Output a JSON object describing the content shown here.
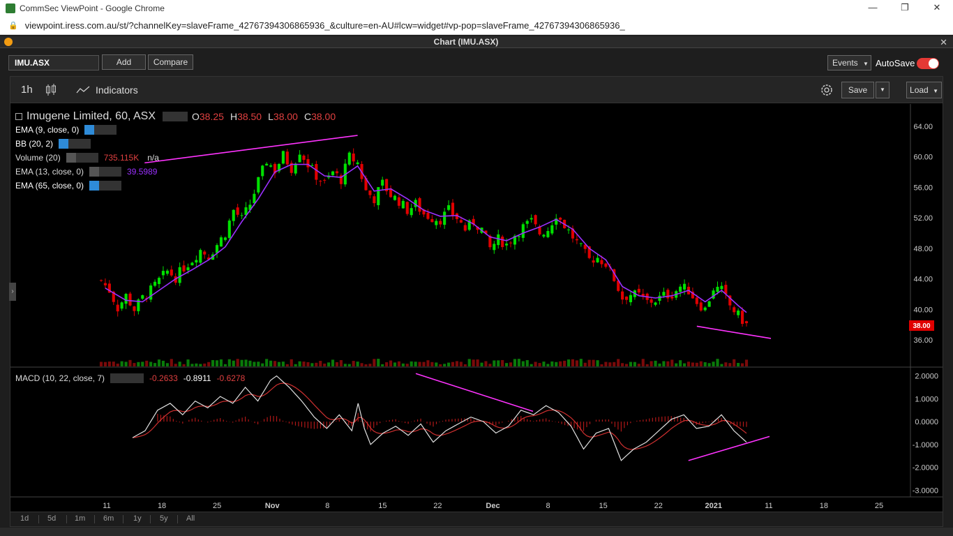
{
  "window": {
    "title": "CommSec ViewPoint - Google Chrome",
    "url": "viewpoint.iress.com.au/st/?channelKey=slaveFrame_42767394306865936_&culture=en-AU#lcw=widget#vp-pop=slaveFrame_42767394306865936_",
    "minimize": "—",
    "restore": "❐",
    "close": "✕"
  },
  "panel": {
    "title": "Chart (IMU.ASX)",
    "close": "✕"
  },
  "toolbar": {
    "symbol": "IMU.ASX",
    "add": "Add",
    "compare": "Compare",
    "events": "Events",
    "autosave": "AutoSave"
  },
  "chart_toolbar": {
    "interval": "1h",
    "indicators": "Indicators",
    "save": "Save",
    "load": "Load"
  },
  "legend": {
    "name": "Imugene Limited, 60, ASX",
    "o_label": "O",
    "o": "38.25",
    "h_label": "H",
    "h": "38.50",
    "l_label": "L",
    "l": "38.00",
    "c_label": "C",
    "c": "38.00",
    "studies": [
      {
        "label": "EMA (9, close, 0)",
        "value": ""
      },
      {
        "label": "BB (20, 2)",
        "value": ""
      },
      {
        "label": "Volume (20)",
        "value": "735.115K",
        "value2": "n/a"
      },
      {
        "label": "EMA (13, close, 0)",
        "value": "39.5989"
      },
      {
        "label": "EMA (65, close, 0)",
        "value": ""
      }
    ],
    "macd_label": "MACD (10, 22, close, 7)",
    "macd_values": [
      "-0.2633",
      "-0.8911",
      "-0.6278"
    ]
  },
  "colors": {
    "up": "#00e000",
    "down": "#e00000",
    "ema": "#9b30ff",
    "trendline": "#ff33ff",
    "price_tag": "#e00000",
    "macd_line": "#e0e0e0",
    "signal_line": "#d03030"
  },
  "last_price_tag": "38.00",
  "chart_data": [
    {
      "type": "candlestick",
      "ylim": [
        34,
        66
      ],
      "y_ticks": [
        "64.00",
        "60.00",
        "56.00",
        "52.00",
        "48.00",
        "44.00",
        "40.00",
        "36.00"
      ],
      "x_ticks": [
        "11",
        "18",
        "25",
        "Nov",
        "8",
        "15",
        "22",
        "Dec",
        "8",
        "15",
        "22",
        "2021",
        "11",
        "18",
        "25"
      ],
      "close_path": [
        [
          0,
          43.8
        ],
        [
          2,
          42.5
        ],
        [
          4,
          40.2
        ],
        [
          6,
          41.8
        ],
        [
          8,
          40.0
        ],
        [
          10,
          41.5
        ],
        [
          12,
          42.5
        ],
        [
          14,
          43.8
        ],
        [
          16,
          45.0
        ],
        [
          18,
          44.2
        ],
        [
          20,
          45.5
        ],
        [
          22,
          46.5
        ],
        [
          24,
          47.8
        ],
        [
          26,
          47.0
        ],
        [
          28,
          48.5
        ],
        [
          30,
          50.0
        ],
        [
          32,
          53.0
        ],
        [
          34,
          51.8
        ],
        [
          36,
          53.8
        ],
        [
          38,
          56.8
        ],
        [
          40,
          59.5
        ],
        [
          42,
          58.2
        ],
        [
          44,
          60.2
        ],
        [
          46,
          58.5
        ],
        [
          48,
          60.8
        ],
        [
          50,
          59.0
        ],
        [
          52,
          57.5
        ],
        [
          54,
          56.5
        ],
        [
          56,
          58.0
        ],
        [
          58,
          57.0
        ],
        [
          60,
          60.0
        ],
        [
          62,
          59.2
        ],
        [
          64,
          55.5
        ],
        [
          66,
          54.5
        ],
        [
          68,
          56.5
        ],
        [
          70,
          55.0
        ],
        [
          72,
          54.2
        ],
        [
          74,
          53.0
        ],
        [
          76,
          53.8
        ],
        [
          78,
          52.5
        ],
        [
          80,
          52.0
        ],
        [
          82,
          51.8
        ],
        [
          84,
          53.0
        ],
        [
          86,
          52.0
        ],
        [
          88,
          50.5
        ],
        [
          90,
          51.5
        ],
        [
          92,
          50.5
        ],
        [
          94,
          48.0
        ],
        [
          96,
          49.2
        ],
        [
          98,
          48.5
        ],
        [
          100,
          49.8
        ],
        [
          102,
          50.8
        ],
        [
          104,
          51.5
        ],
        [
          106,
          50.0
        ],
        [
          108,
          50.5
        ],
        [
          110,
          52.5
        ],
        [
          112,
          51.0
        ],
        [
          114,
          49.5
        ],
        [
          116,
          48.0
        ],
        [
          118,
          46.5
        ],
        [
          120,
          46.8
        ],
        [
          122,
          46.0
        ],
        [
          124,
          44.0
        ],
        [
          126,
          41.5
        ],
        [
          128,
          42.0
        ],
        [
          130,
          41.8
        ],
        [
          132,
          41.0
        ],
        [
          134,
          41.2
        ],
        [
          136,
          41.8
        ],
        [
          138,
          42.0
        ],
        [
          140,
          43.0
        ],
        [
          142,
          42.5
        ],
        [
          144,
          41.0
        ],
        [
          146,
          40.0
        ],
        [
          148,
          42.8
        ],
        [
          150,
          42.5
        ],
        [
          152,
          40.5
        ],
        [
          154,
          39.2
        ],
        [
          156,
          38.0
        ]
      ],
      "ema_path": [
        [
          1,
          42.8
        ],
        [
          6,
          41.2
        ],
        [
          10,
          41.0
        ],
        [
          14,
          42.5
        ],
        [
          18,
          44.0
        ],
        [
          22,
          45.2
        ],
        [
          26,
          46.5
        ],
        [
          30,
          48.2
        ],
        [
          34,
          51.5
        ],
        [
          38,
          54.5
        ],
        [
          42,
          58.0
        ],
        [
          46,
          59.0
        ],
        [
          50,
          59.0
        ],
        [
          54,
          57.5
        ],
        [
          58,
          57.3
        ],
        [
          62,
          58.8
        ],
        [
          66,
          55.5
        ],
        [
          70,
          55.8
        ],
        [
          74,
          54.5
        ],
        [
          78,
          53.0
        ],
        [
          82,
          52.2
        ],
        [
          86,
          52.3
        ],
        [
          90,
          51.2
        ],
        [
          94,
          49.5
        ],
        [
          98,
          49.0
        ],
        [
          102,
          50.0
        ],
        [
          106,
          50.8
        ],
        [
          110,
          51.8
        ],
        [
          114,
          50.5
        ],
        [
          118,
          48.0
        ],
        [
          122,
          46.5
        ],
        [
          126,
          43.0
        ],
        [
          130,
          41.8
        ],
        [
          134,
          41.5
        ],
        [
          138,
          41.8
        ],
        [
          142,
          42.5
        ],
        [
          146,
          41.0
        ],
        [
          150,
          42.5
        ],
        [
          154,
          40.5
        ],
        [
          156,
          39.6
        ]
      ],
      "trendline_top": [
        [
          60.5,
          59.2
        ],
        [
          112,
          62.8
        ]
      ],
      "trendline_bottom": [
        [
          1143,
          37.8
        ],
        [
          1520,
          36.2
        ]
      ]
    },
    {
      "type": "line",
      "name": "MACD",
      "ylim": [
        -3.2,
        2.2
      ],
      "y_ticks": [
        "2.0000",
        "1.0000",
        "0.0000",
        "-1.0000",
        "-2.0000",
        "-3.0000"
      ],
      "macd_path": [
        [
          0,
          -0.7
        ],
        [
          4,
          -0.4
        ],
        [
          8,
          0.5
        ],
        [
          12,
          0.8
        ],
        [
          16,
          0.3
        ],
        [
          20,
          0.9
        ],
        [
          24,
          0.6
        ],
        [
          28,
          1.1
        ],
        [
          32,
          0.8
        ],
        [
          36,
          1.5
        ],
        [
          40,
          0.9
        ],
        [
          44,
          1.8
        ],
        [
          46,
          2.0
        ],
        [
          50,
          1.5
        ],
        [
          54,
          0.9
        ],
        [
          58,
          0.2
        ],
        [
          62,
          -0.3
        ],
        [
          66,
          0.3
        ],
        [
          70,
          -0.4
        ],
        [
          72,
          0.8
        ],
        [
          74,
          -0.3
        ],
        [
          76,
          -1.0
        ],
        [
          80,
          -0.5
        ],
        [
          84,
          -0.2
        ],
        [
          88,
          -0.6
        ],
        [
          92,
          -0.1
        ],
        [
          96,
          -0.9
        ],
        [
          100,
          -0.4
        ],
        [
          104,
          -0.1
        ],
        [
          108,
          0.2
        ],
        [
          112,
          0.0
        ],
        [
          116,
          -0.5
        ],
        [
          120,
          -0.2
        ],
        [
          124,
          0.5
        ],
        [
          128,
          0.3
        ],
        [
          132,
          0.7
        ],
        [
          136,
          0.4
        ],
        [
          140,
          -0.2
        ],
        [
          144,
          -1.2
        ],
        [
          148,
          -0.5
        ],
        [
          152,
          -0.3
        ],
        [
          156,
          -1.7
        ],
        [
          160,
          -1.2
        ],
        [
          164,
          -0.9
        ],
        [
          168,
          -0.4
        ],
        [
          172,
          0.1
        ],
        [
          176,
          0.3
        ],
        [
          180,
          -0.3
        ],
        [
          184,
          -0.2
        ],
        [
          188,
          0.3
        ],
        [
          192,
          -0.4
        ],
        [
          196,
          -0.9
        ]
      ],
      "trendline_top": [
        [
          0.55,
          2.1
        ],
        [
          0.7,
          0.45
        ]
      ],
      "trendline_bottom": [
        [
          0.877,
          -1.7
        ],
        [
          1.0,
          -0.65
        ]
      ]
    }
  ],
  "range_buttons": [
    "1d",
    "5d",
    "1m",
    "6m",
    "1y",
    "5y",
    "All"
  ]
}
